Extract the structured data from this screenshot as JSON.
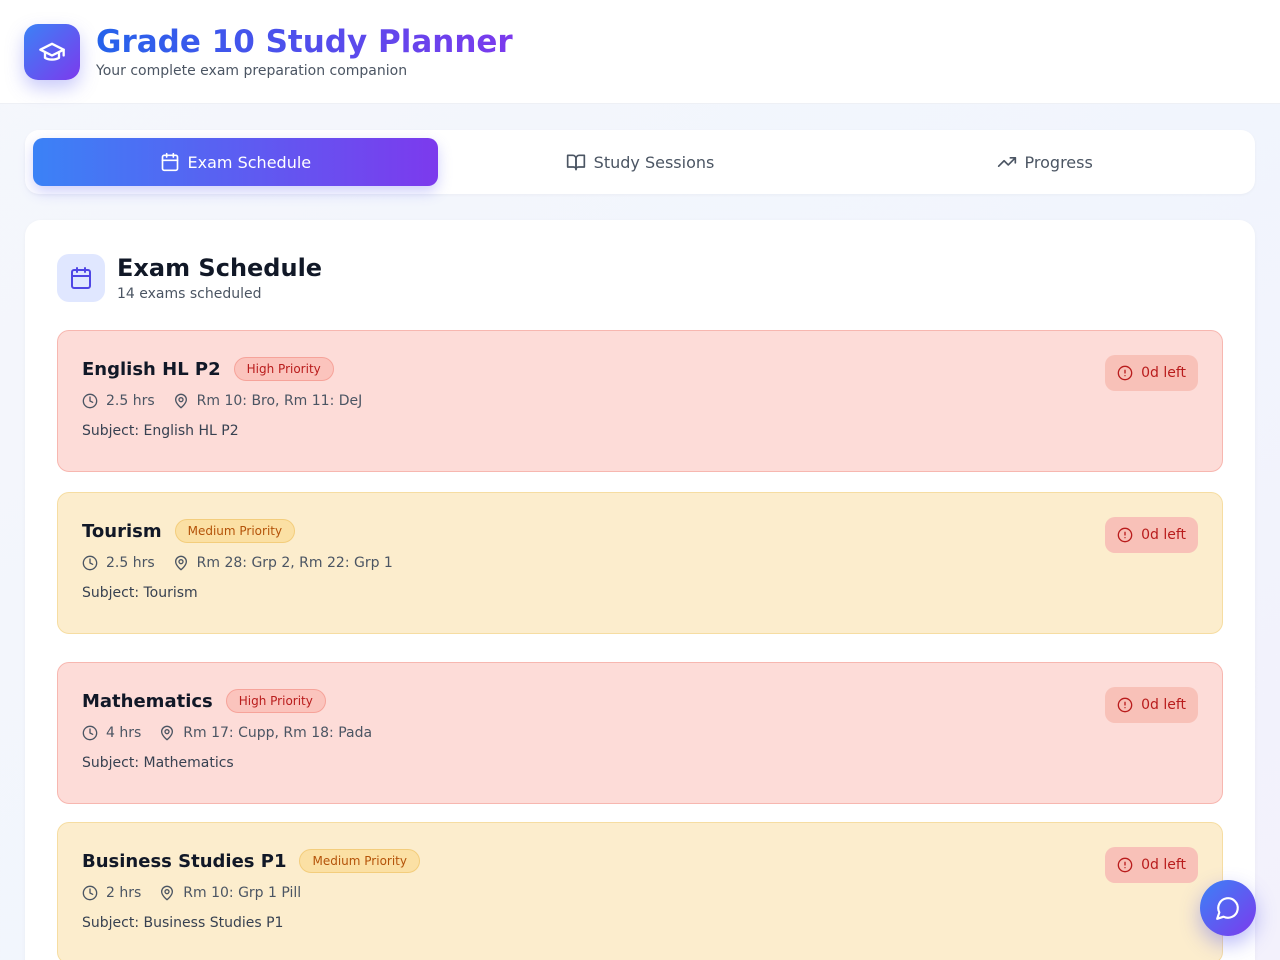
{
  "header": {
    "title": "Grade 10 Study Planner",
    "subtitle": "Your complete exam preparation companion",
    "logo_icon": "graduation-cap-icon"
  },
  "tabs": [
    {
      "label": "Exam Schedule",
      "icon": "calendar-icon",
      "active": true
    },
    {
      "label": "Study Sessions",
      "icon": "book-open-icon",
      "active": false
    },
    {
      "label": "Progress",
      "icon": "trending-up-icon",
      "active": false
    }
  ],
  "panel": {
    "title": "Exam Schedule",
    "subtitle": "14 exams scheduled",
    "icon": "calendar-icon"
  },
  "exams": [
    {
      "name": "English HL P2",
      "priority": "High Priority",
      "priority_level": "high",
      "duration": "2.5 hrs",
      "rooms": "Rm 10: Bro, Rm 11: DeJ",
      "subject": "Subject: English HL P2",
      "days_left": "0d left"
    },
    {
      "name": "Tourism",
      "priority": "Medium Priority",
      "priority_level": "medium",
      "duration": "2.5 hrs",
      "rooms": "Rm 28: Grp 2, Rm 22: Grp 1",
      "subject": "Subject: Tourism",
      "days_left": "0d left"
    },
    {
      "name": "Mathematics",
      "priority": "High Priority",
      "priority_level": "high",
      "duration": "4 hrs",
      "rooms": "Rm 17: Cupp, Rm 18: Pada",
      "subject": "Subject: Mathematics",
      "days_left": "0d left"
    },
    {
      "name": "Business Studies P1",
      "priority": "Medium Priority",
      "priority_level": "medium",
      "duration": "2 hrs",
      "rooms": "Rm 10: Grp 1 Pill",
      "subject": "Subject: Business Studies P1",
      "days_left": "0d left"
    }
  ],
  "chat_button": {
    "icon": "chat-bubble-icon"
  },
  "colors": {
    "accent_start": "#3b82f6",
    "accent_end": "#7c3aed",
    "high_bg": "#fddcd8",
    "medium_bg": "#fcedcd",
    "days_left_text": "#b91c1c"
  }
}
